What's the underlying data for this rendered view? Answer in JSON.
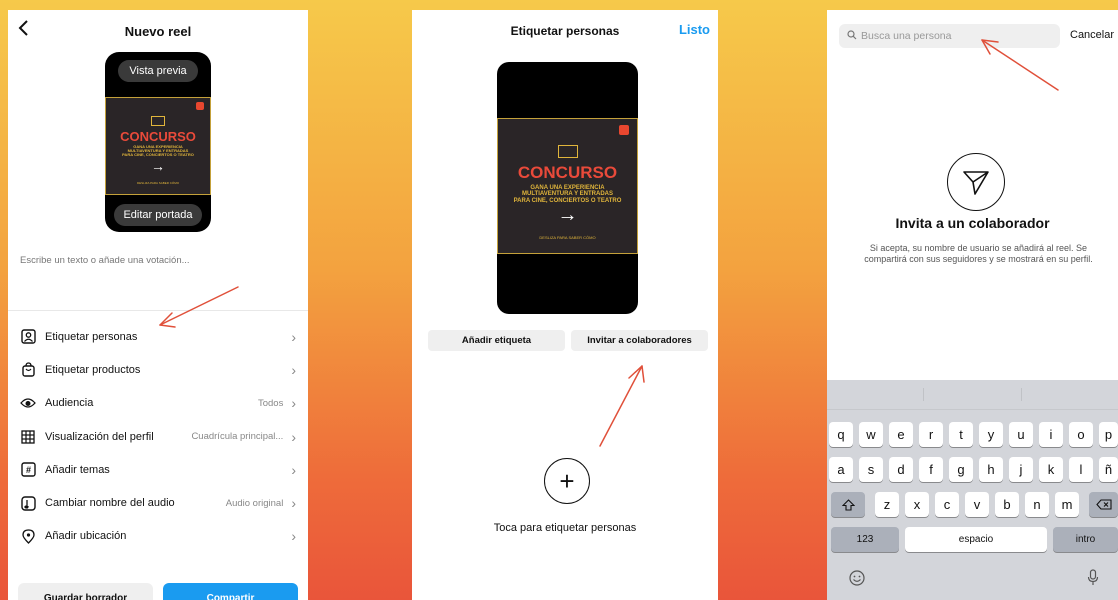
{
  "screen1": {
    "title": "Nuevo reel",
    "back_icon": "chevron-left-icon",
    "preview_label": "Vista previa",
    "edit_cover_label": "Editar portada",
    "poster": {
      "headline": "CONCURSO",
      "sub_lines": [
        "GANA UNA EXPERIENCIA",
        "MULTIAVENTURA Y ENTRADAS",
        "PARA CINE, CONCIERTOS O TEATRO"
      ],
      "arrow": "→",
      "tiny": "DESLIZA PARA SABER CÓMO"
    },
    "caption_placeholder": "Escribe un texto o añade una votación...",
    "menu": [
      {
        "icon": "person-tag-icon",
        "label": "Etiquetar personas",
        "value": ""
      },
      {
        "icon": "shopping-bag-icon",
        "label": "Etiquetar productos",
        "value": ""
      },
      {
        "icon": "eye-icon",
        "label": "Audiencia",
        "value": "Todos"
      },
      {
        "icon": "grid-icon",
        "label": "Visualización del perfil",
        "value": "Cuadrícula principal..."
      },
      {
        "icon": "hashtag-icon",
        "label": "Añadir temas",
        "value": ""
      },
      {
        "icon": "audio-icon",
        "label": "Cambiar nombre del audio",
        "value": "Audio original"
      },
      {
        "icon": "location-icon",
        "label": "Añadir ubicación",
        "value": ""
      }
    ],
    "save_draft": "Guardar borrador",
    "share": "Compartir"
  },
  "screen2": {
    "title": "Etiquetar personas",
    "done": "Listo",
    "poster": {
      "headline": "CONCURSO",
      "sub_lines": [
        "GANA UNA EXPERIENCIA",
        "MULTIAVENTURA Y ENTRADAS",
        "PARA CINE, CONCIERTOS O TEATRO"
      ],
      "arrow": "→",
      "tiny": "DESLIZA PARA SABER CÓMO"
    },
    "add_tag": "Añadir etiqueta",
    "invite_collab": "Invitar a colaboradores",
    "plus": "+",
    "tap_hint": "Toca para etiquetar personas"
  },
  "screen3": {
    "search_placeholder": "Busca una persona",
    "cancel": "Cancelar",
    "title": "Invita a un colaborador",
    "description": "Si acepta, su nombre de usuario se añadirá al reel. Se compartirá con sus seguidores y se mostrará en su perfil.",
    "keyboard": {
      "row1": [
        "q",
        "w",
        "e",
        "r",
        "t",
        "y",
        "u",
        "i",
        "o",
        "p"
      ],
      "row2": [
        "a",
        "s",
        "d",
        "f",
        "g",
        "h",
        "j",
        "k",
        "l",
        "ñ"
      ],
      "row3": [
        "z",
        "x",
        "c",
        "v",
        "b",
        "n",
        "m"
      ],
      "numbers": "123",
      "space": "espacio",
      "enter": "intro",
      "shift_icon": "shift-icon",
      "backspace_icon": "backspace-icon",
      "emoji_icon": "emoji-icon",
      "mic_icon": "microphone-icon"
    }
  },
  "colors": {
    "accent_blue": "#1a9bf0",
    "annotation_arrow": "#e0503a",
    "poster_red": "#e94a3a",
    "poster_gold": "#e0b53b"
  }
}
